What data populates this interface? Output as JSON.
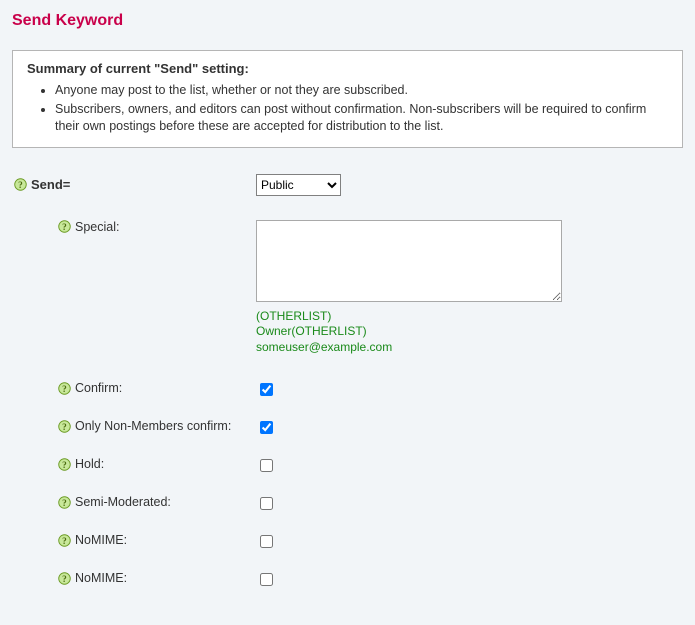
{
  "title": "Send Keyword",
  "summary": {
    "heading": "Summary of current \"Send\" setting:",
    "items": [
      "Anyone may post to the list, whether or not they are subscribed.",
      "Subscribers, owners, and editors can post without confirmation. Non-subscribers will be required to confirm their own postings before these are accepted for distribution to the list."
    ]
  },
  "main_select": {
    "label": "Send=",
    "value": "Public"
  },
  "special": {
    "label": "Special:",
    "value": "",
    "examples": [
      "(OTHERLIST)",
      "Owner(OTHERLIST)",
      "someuser@example.com"
    ]
  },
  "cb": {
    "confirm": {
      "label": "Confirm:",
      "checked": true
    },
    "only_nonmembers": {
      "label": "Only Non-Members confirm:",
      "checked": true
    },
    "hold": {
      "label": "Hold:",
      "checked": false
    },
    "semi_moderated": {
      "label": "Semi-Moderated:",
      "checked": false
    },
    "nomime1": {
      "label": "NoMIME:",
      "checked": false
    },
    "nomime2": {
      "label": "NoMIME:",
      "checked": false
    }
  }
}
